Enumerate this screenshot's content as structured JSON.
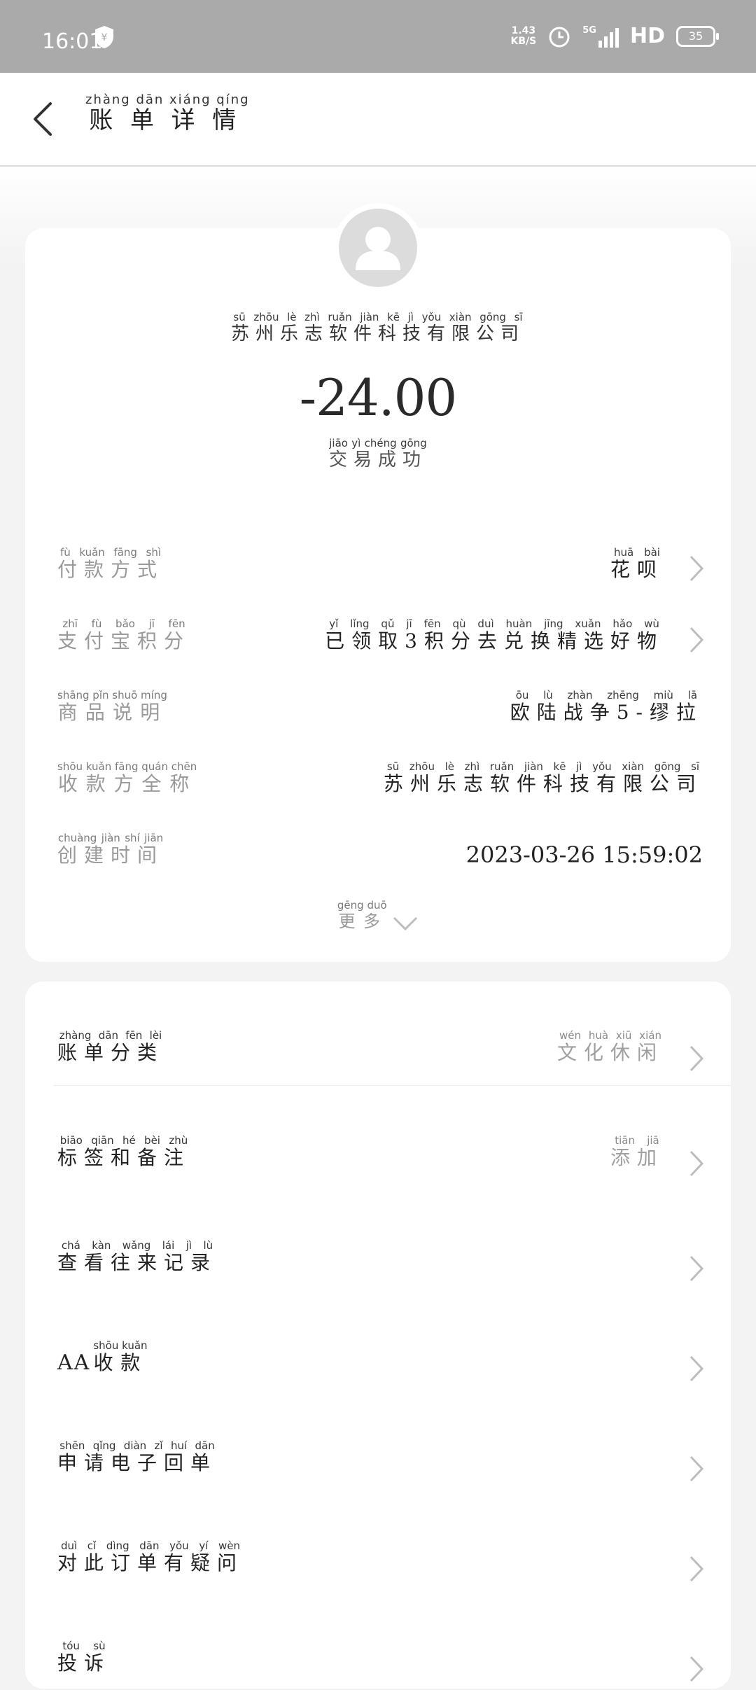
{
  "status_bar": {
    "time": "16:01",
    "net_speed_value": "1.43",
    "net_speed_unit": "KB/S",
    "signal": "5G",
    "hd": "HD",
    "battery": "35"
  },
  "header": {
    "title": "账单详情",
    "title_pinyin": "zhàng dān xiáng qíng"
  },
  "summary": {
    "merchant": "苏州乐志软件科技有限公司",
    "merchant_pinyin": "sū zhōu lè zhì ruǎn jiàn kē jì yǒu xiàn gōng sī",
    "amount": "-24.00",
    "status": "交易成功",
    "status_pinyin": "jiāo yì chéng gōng"
  },
  "details": {
    "payment_method": {
      "label": "付款方式",
      "label_pinyin": "fù kuǎn fāng shì",
      "value": "花呗",
      "value_pinyin": "huā bài"
    },
    "alipay_points": {
      "label": "支付宝积分",
      "label_pinyin": "zhī fù bǎo jī fēn",
      "value": "已领取3积分去兑换精选好物",
      "value_pinyin": "yǐ lǐng qǔ jī fēn qù duì huàn jīng xuǎn hǎo wù"
    },
    "product_desc": {
      "label": "商品说明",
      "label_pinyin": "shāng pǐn shuō míng",
      "value": "欧陆战争5-缪拉",
      "value_pinyin": "ōu lù zhàn zhēng miù lā"
    },
    "payee_name": {
      "label": "收款方全称",
      "label_pinyin": "shōu kuǎn fāng quán chēn",
      "value": "苏州乐志软件科技有限公司",
      "value_pinyin": "sū zhōu lè zhì ruǎn jiàn kē jì yǒu xiàn gōng sī"
    },
    "created_time": {
      "label": "创建时间",
      "label_pinyin": "chuàng jiàn shí jiān",
      "value": "2023-03-26 15:59:02"
    },
    "more": "更多",
    "more_pinyin": "gēng duō"
  },
  "actions": {
    "category": {
      "label": "账单分类",
      "label_pinyin": "zhàng dān fēn lèi",
      "value": "文化休闲",
      "value_pinyin": "wén huà xiū xián"
    },
    "tags": {
      "label": "标签和备注",
      "label_pinyin": "biāo qiān hé bèi zhù",
      "value": "添加",
      "value_pinyin": "tiān jiā"
    },
    "history": {
      "label": "查看往来记录",
      "label_pinyin": "chá kàn wǎng lái jì lù"
    },
    "aa": {
      "prefix": "AA",
      "label": "收款",
      "label_pinyin": "shōu kuǎn"
    },
    "receipt": {
      "label": "申请电子回单",
      "label_pinyin": "shēn qǐng diàn zǐ huí dān"
    },
    "dispute": {
      "label": "对此订单有疑问",
      "label_pinyin": "duì cǐ dìng dān yǒu yí wèn"
    },
    "complaint": {
      "label": "投诉",
      "label_pinyin": "tóu sù"
    }
  },
  "colors": {
    "status_bar": "#aaaaaa",
    "page_bg": "#f3f3f3",
    "card_bg": "#ffffff",
    "muted_text": "#9a9a9a"
  }
}
